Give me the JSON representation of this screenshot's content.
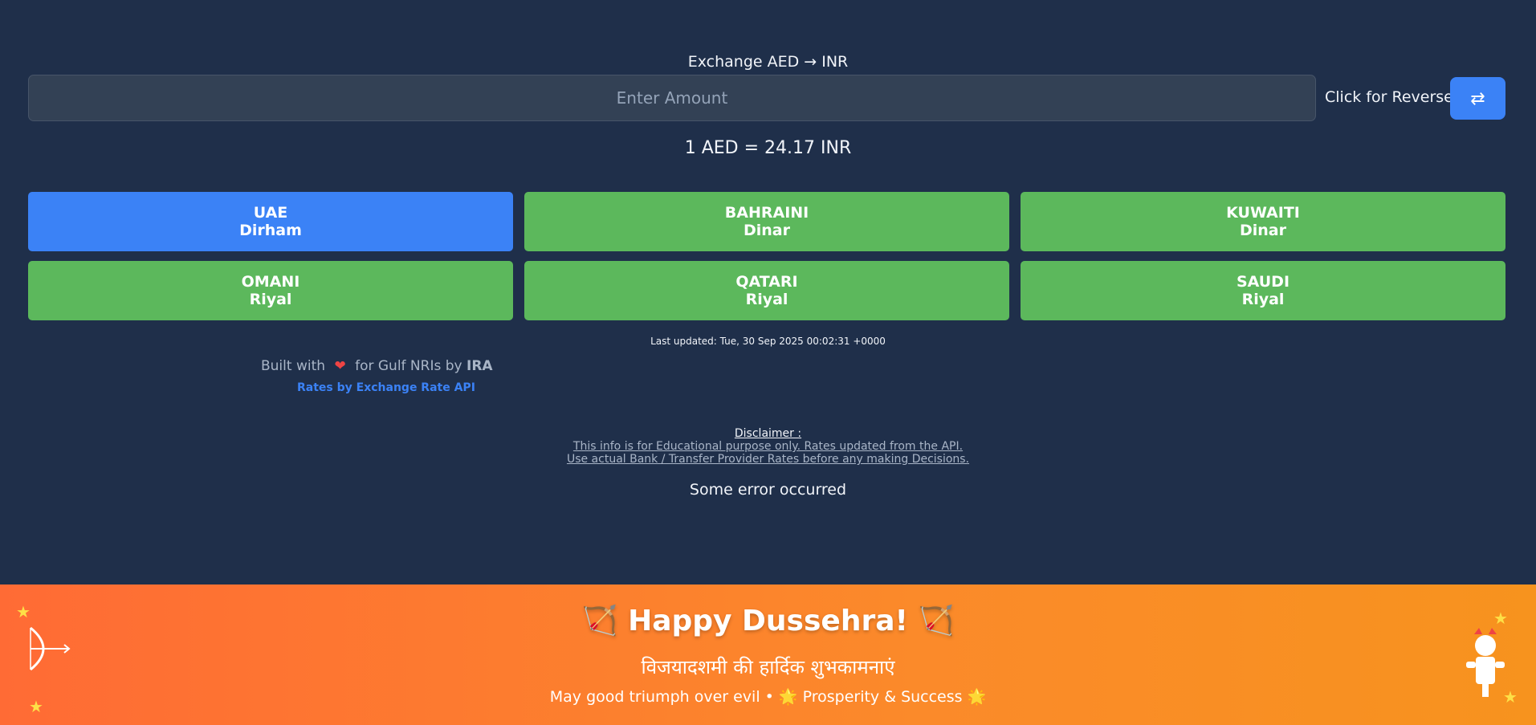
{
  "header": {
    "title": "Exchange AED → INR",
    "amount_placeholder": "Enter Amount",
    "reverse_label": "Click for Reverse",
    "reverse_icon": "⇄"
  },
  "rate": "1 AED = 24.17 INR",
  "currencies": [
    {
      "country": "UAE",
      "unit": "Dirham",
      "active": true
    },
    {
      "country": "BAHRAINI",
      "unit": "Dinar",
      "active": false
    },
    {
      "country": "KUWAITI",
      "unit": "Dinar",
      "active": false
    },
    {
      "country": "OMANI",
      "unit": "Riyal",
      "active": false
    },
    {
      "country": "QATARI",
      "unit": "Riyal",
      "active": false
    },
    {
      "country": "SAUDI",
      "unit": "Riyal",
      "active": false
    }
  ],
  "last_updated": "Last updated: Tue, 30 Sep 2025 00:02:31 +0000",
  "footer": {
    "built_prefix": "Built with",
    "built_middle": "for Gulf NRIs by",
    "author": "IRA",
    "rates_link": "Rates by Exchange Rate API"
  },
  "disclaimer": {
    "title": "Disclaimer :",
    "line1": "This info is for Educational purpose only. Rates updated from the API.",
    "line2": "Use actual Bank / Transfer Provider Rates before any making Decisions."
  },
  "error": "Some error occurred",
  "banner": {
    "title": "🏹 Happy Dussehra! 🏹",
    "hindi": "विजयादशमी की हार्दिक शुभकामनाएं",
    "subtitle": "May good triumph over evil • 🌟 Prosperity & Success 🌟"
  },
  "colors": {
    "background": "#1f2f4a",
    "active": "#3b82f6",
    "currency": "#5cb85c",
    "banner": "#ff6b35"
  }
}
